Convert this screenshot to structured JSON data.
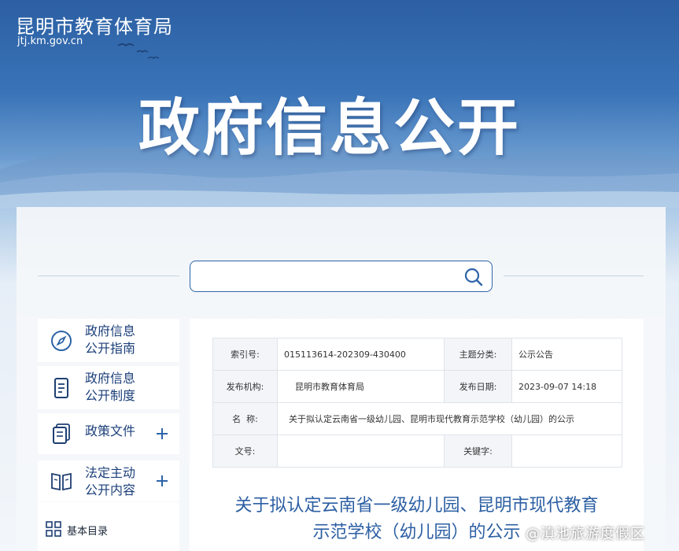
{
  "header": {
    "site_name": "昆明市教育体育局",
    "site_url": "jtj.km.gov.cn",
    "hero_title": "政府信息公开"
  },
  "search": {
    "value": "",
    "placeholder": ""
  },
  "sidebar": {
    "items": [
      {
        "label": "政府信息\n公开指南",
        "icon": "compass-icon",
        "expandable": false
      },
      {
        "label": "政府信息\n公开制度",
        "icon": "document-icon",
        "expandable": false
      },
      {
        "label": "政策文件",
        "icon": "files-icon",
        "expandable": true
      },
      {
        "label": "法定主动\n公开内容",
        "icon": "book-icon",
        "expandable": true
      }
    ],
    "sub_items": [
      {
        "label": "基本目录",
        "icon": "grid-icon"
      }
    ]
  },
  "meta": {
    "index_label": "索引号:",
    "index_value": "015113614-202309-430400",
    "category_label": "主题分类:",
    "category_value": "公示公告",
    "publisher_label": "发布机构:",
    "publisher_value": "昆明市教育体育局",
    "date_label": "发布日期:",
    "date_value": "2023-09-07 14:18",
    "name_label": "名  称:",
    "name_value": "关于拟认定云南省一级幼儿园、昆明市现代教育示范学校（幼儿园）的公示",
    "doc_no_label": "文号:",
    "doc_no_value": "",
    "keywords_label": "关键字:",
    "keywords_value": ""
  },
  "article": {
    "title_line1": "关于拟认定云南省一级幼儿园、昆明市现代教育",
    "title_line2": "示范学校（幼儿园）的公示"
  },
  "watermark": "@滇池旅游度假区",
  "colors": {
    "brand_blue": "#2c5fa3",
    "nav_text": "#1c3f7a",
    "table_header_bg": "#f3f5f8"
  }
}
